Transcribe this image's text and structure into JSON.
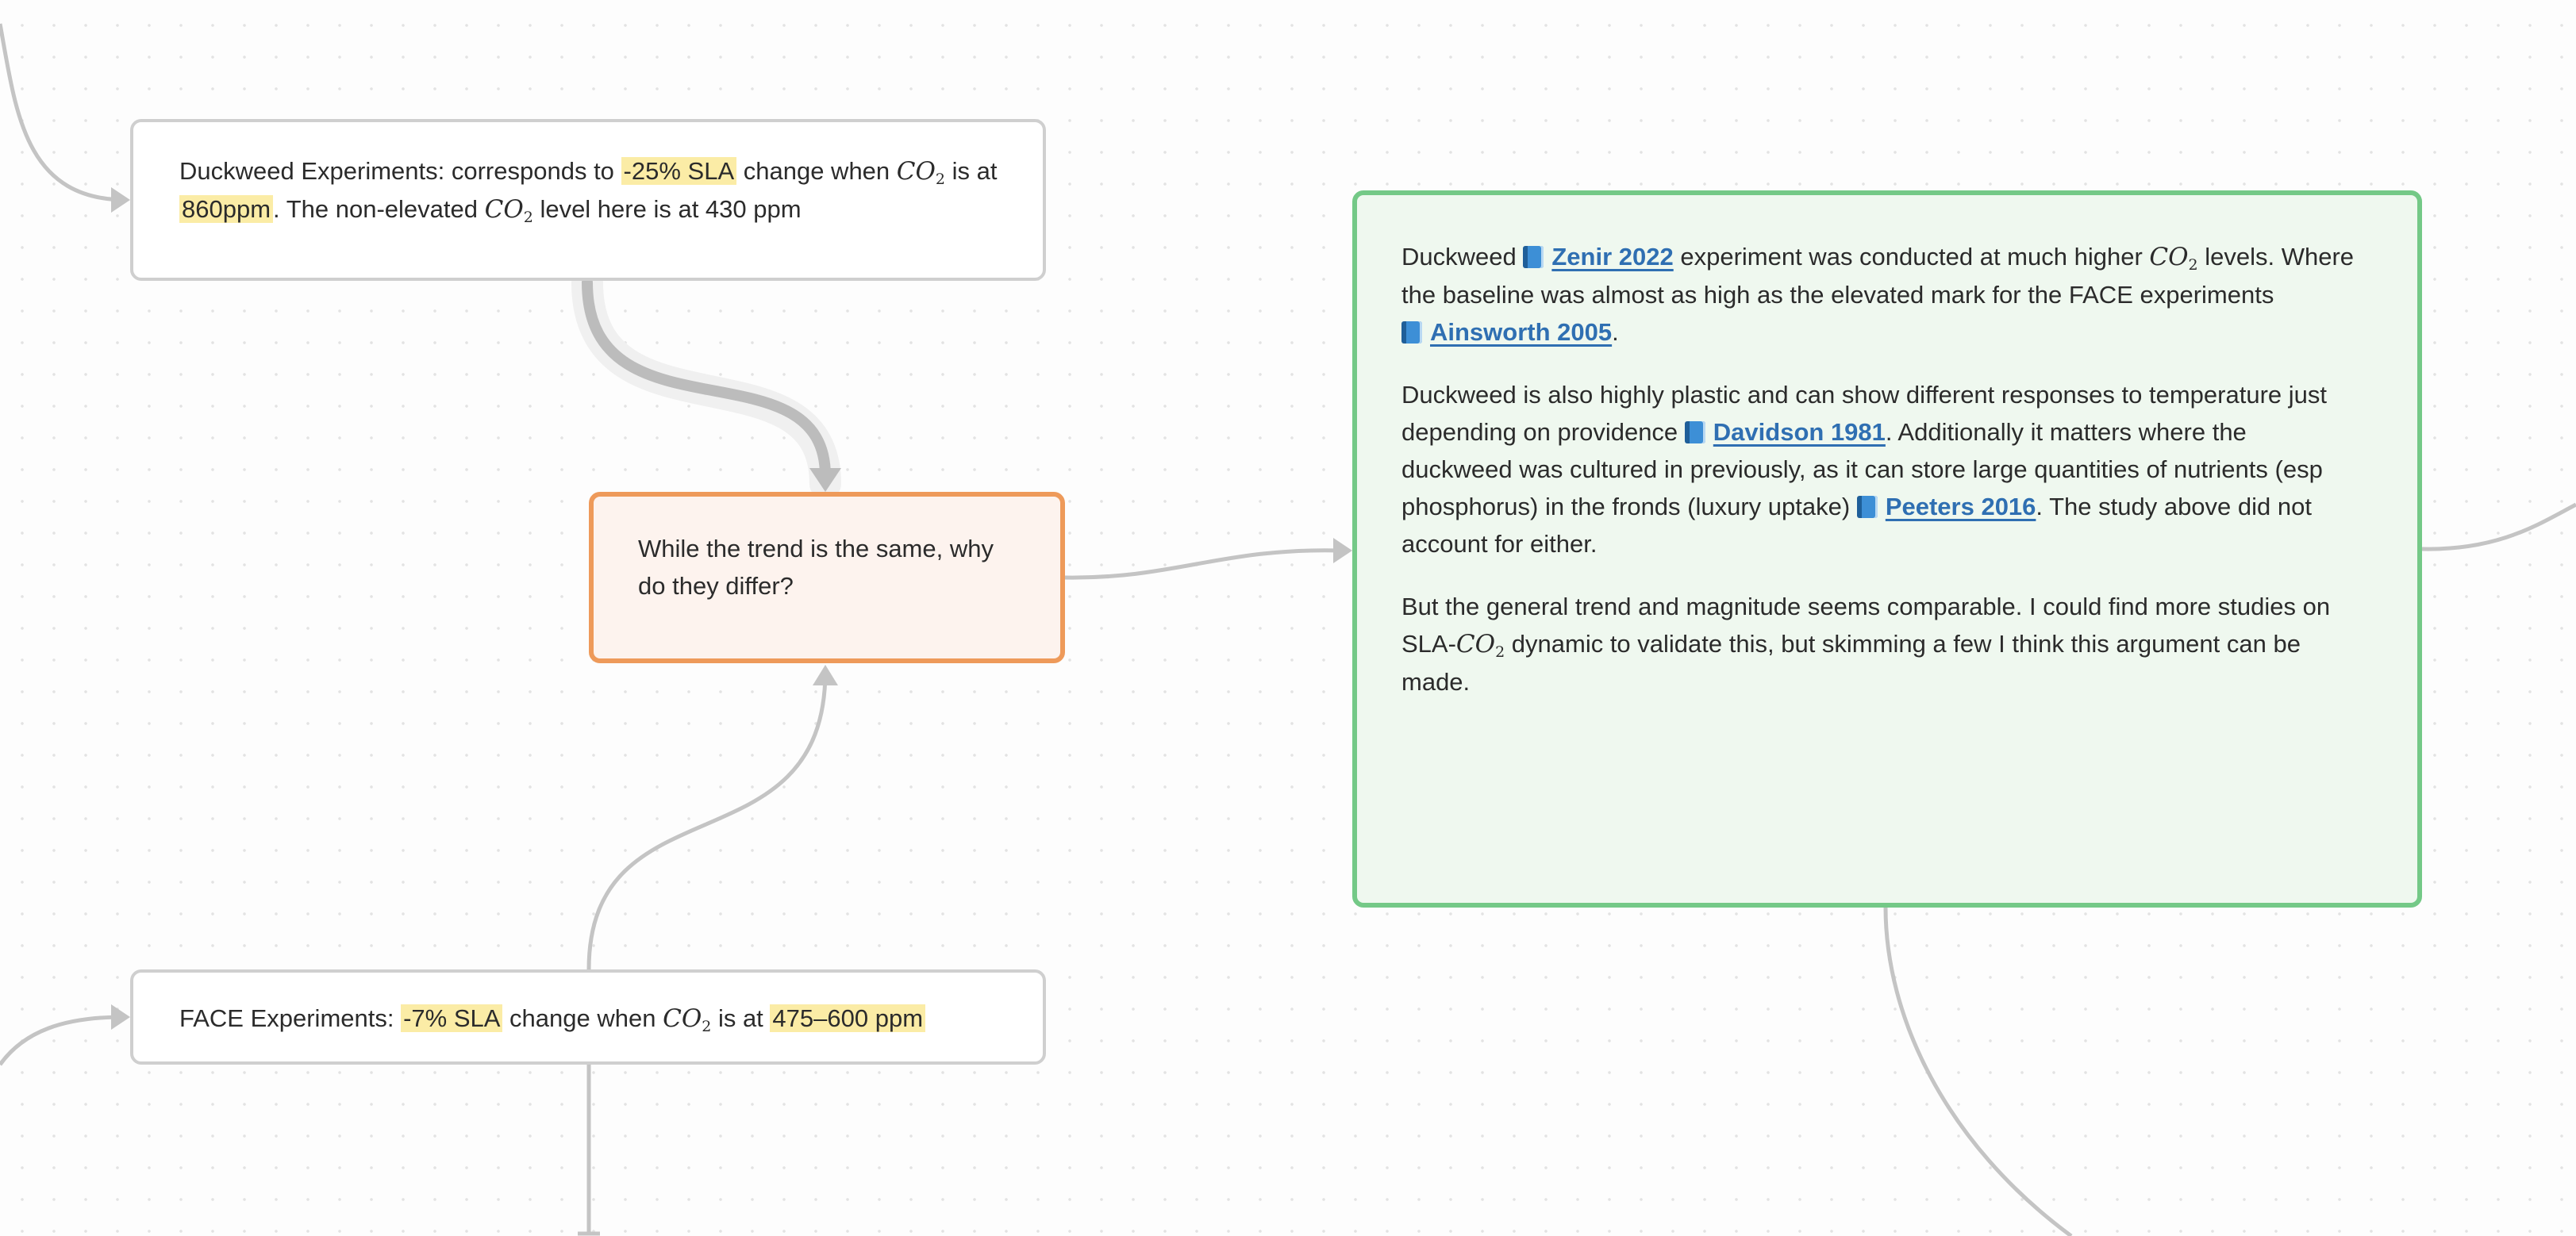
{
  "canvas": {
    "background_color": "#fdfdfd",
    "edge_color": "#c4c4c4",
    "highlight_color": "#fbeca6",
    "link_color": "#2f6fb2"
  },
  "nodes": {
    "duckweed_experiments": {
      "border_color": "#cfcfcf",
      "text_a": "Duckweed Experiments: corresponds to ",
      "highlight_sla": "-25% SLA",
      "text_b": " change when ",
      "text_c": " is at ",
      "highlight_ppm": "860ppm",
      "text_d": ". The non-elevated ",
      "text_e": " level here is at 430 ppm"
    },
    "question": {
      "border_color": "#ee9a5a",
      "background": "#fdf3ee",
      "text": "While the trend is the same, why do they differ?"
    },
    "face_experiments": {
      "border_color": "#cfcfcf",
      "text_a": "FACE Experiments: ",
      "highlight_sla": "-7% SLA",
      "text_b": " change when ",
      "text_c": " is at ",
      "highlight_ppm": "475–600 ppm"
    },
    "analysis": {
      "border_color": "#74c987",
      "background": "#eff8ef",
      "p1": {
        "t1": "Duckweed ",
        "cite1": "Zenir 2022",
        "t2": " experiment was conducted at much higher ",
        "t3": " levels. Where the baseline was almost as high as the elevated mark for the FACE experiments ",
        "cite2": "Ainsworth 2005",
        "t4": "."
      },
      "p2": {
        "t1": "Duckweed is also highly plastic and can show different responses to temperature just depending on providence ",
        "cite1": "Davidson 1981",
        "t2": ". Additionally it matters where the duckweed was cultured in previously, as it can store large quantities of nutrients (esp phosphorus) in the fronds (luxury uptake) ",
        "cite2": "Peeters 2016",
        "t3": ". The study above did not account for either."
      },
      "p3": {
        "t1": "But the general trend and magnitude seems comparable. I could find more studies on SLA-",
        "t2": " dynamic to validate this, but skimming a few I think this argument can be made."
      }
    }
  },
  "co2": {
    "base": "CO",
    "sub": "2"
  },
  "icons": {
    "citation": "book-icon"
  }
}
